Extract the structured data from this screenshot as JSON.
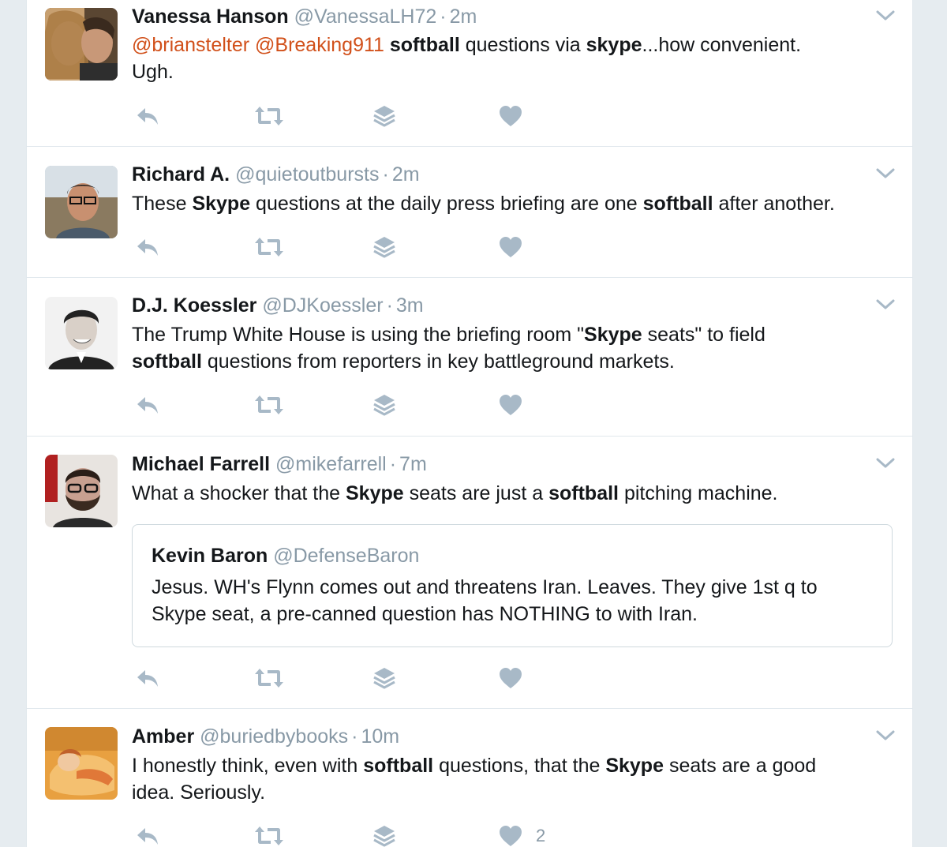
{
  "colors": {
    "mention": "#d1501a",
    "muted": "#8899a6",
    "icon": "#a8b9c7",
    "border": "#e1e8ed"
  },
  "icons": [
    "reply-icon",
    "retweet-icon",
    "dm-icon",
    "like-icon",
    "chevron-down-icon"
  ],
  "tweets": [
    {
      "name": "Vanessa Hanson",
      "handle": "@VanessaLH72",
      "sep": "·",
      "time": "2m",
      "m1": "@brianstelter",
      "m2": "@Breaking911",
      "b1": "softball",
      "t1": " questions via ",
      "b2": "skype",
      "t2": "...how convenient.",
      "t3": "Ugh."
    },
    {
      "name": "Richard A.",
      "handle": "@quietoutbursts",
      "sep": "·",
      "time": "2m",
      "t1": "These ",
      "b1": "Skype",
      "t2": " questions at the daily press briefing are one ",
      "b2": "softball",
      "t3": " after another."
    },
    {
      "name": "D.J. Koessler",
      "handle": "@DJKoessler",
      "sep": "·",
      "time": "3m",
      "t1": "The Trump White House is using the briefing room \"",
      "b1": "Skype",
      "t2": " seats\" to field",
      "b2": "softball",
      "t3": " questions from reporters in key battleground markets."
    },
    {
      "name": "Michael Farrell",
      "handle": "@mikefarrell",
      "sep": "·",
      "time": "7m",
      "t1": "What a shocker that the ",
      "b1": "Skype",
      "t2": " seats are just a ",
      "b2": "softball",
      "t3": " pitching machine.",
      "quote": {
        "name": "Kevin Baron",
        "handle": "@DefenseBaron",
        "line1": "Jesus. WH's Flynn comes out and threatens Iran. Leaves. They give 1st q to",
        "line2": "Skype seat, a pre-canned question has NOTHING to with Iran."
      }
    },
    {
      "name": "Amber",
      "handle": "@buriedbybooks",
      "sep": "·",
      "time": "10m",
      "t1": "I honestly think, even with ",
      "b1": "softball",
      "t2": " questions, that the ",
      "b2": "Skype",
      "t3": " seats are a good",
      "t4": "idea. Seriously.",
      "likes": "2"
    }
  ]
}
